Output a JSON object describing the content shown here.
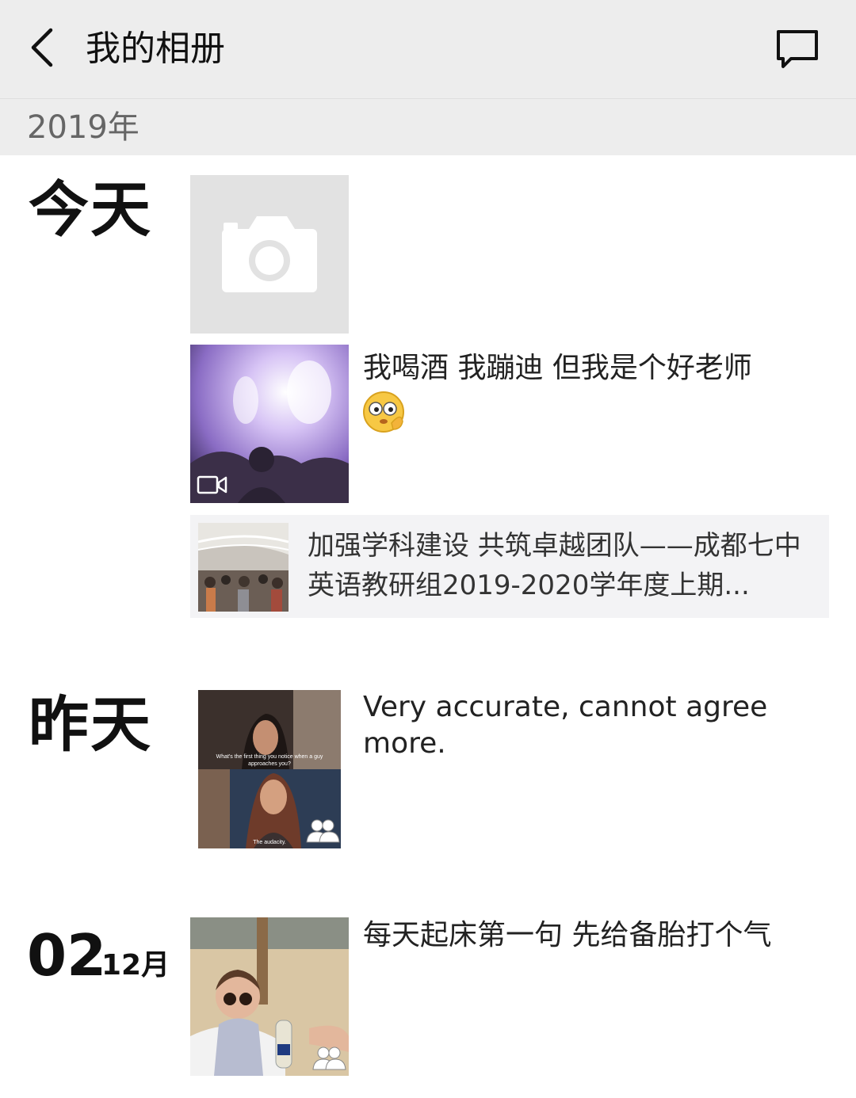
{
  "header": {
    "title": "我的相册",
    "back_icon": "chevron-left-icon",
    "message_icon": "chat-bubble-icon"
  },
  "year_section": {
    "label": "2019年"
  },
  "days": [
    {
      "label": "今天",
      "posts": [
        {
          "type": "camera-placeholder",
          "icon": "camera-icon"
        },
        {
          "type": "video",
          "text": "我喝酒 我蹦迪 但我是个好老师",
          "emoji": "shy-emoji-icon",
          "badge_icon": "video-icon"
        },
        {
          "type": "link",
          "title": "加强学科建设 共筑卓越团队——成都七中英语教研组2019-2020学年度上期..."
        }
      ]
    },
    {
      "label": "昨天",
      "posts": [
        {
          "type": "image",
          "text": "Very accurate, cannot agree more.",
          "badge_icon": "group-visibility-icon",
          "caption_top": "What's the first thing you notice when a guy approaches you?",
          "caption_bottom": "The audacity."
        }
      ]
    },
    {
      "day": "02",
      "month": "12月",
      "posts": [
        {
          "type": "image",
          "text": "每天起床第一句 先给备胎打个气",
          "badge_icon": "group-visibility-icon"
        }
      ]
    }
  ],
  "colors": {
    "header_bg": "#ededed",
    "placeholder_bg": "#e2e2e2",
    "link_card_bg": "#f3f3f5"
  }
}
